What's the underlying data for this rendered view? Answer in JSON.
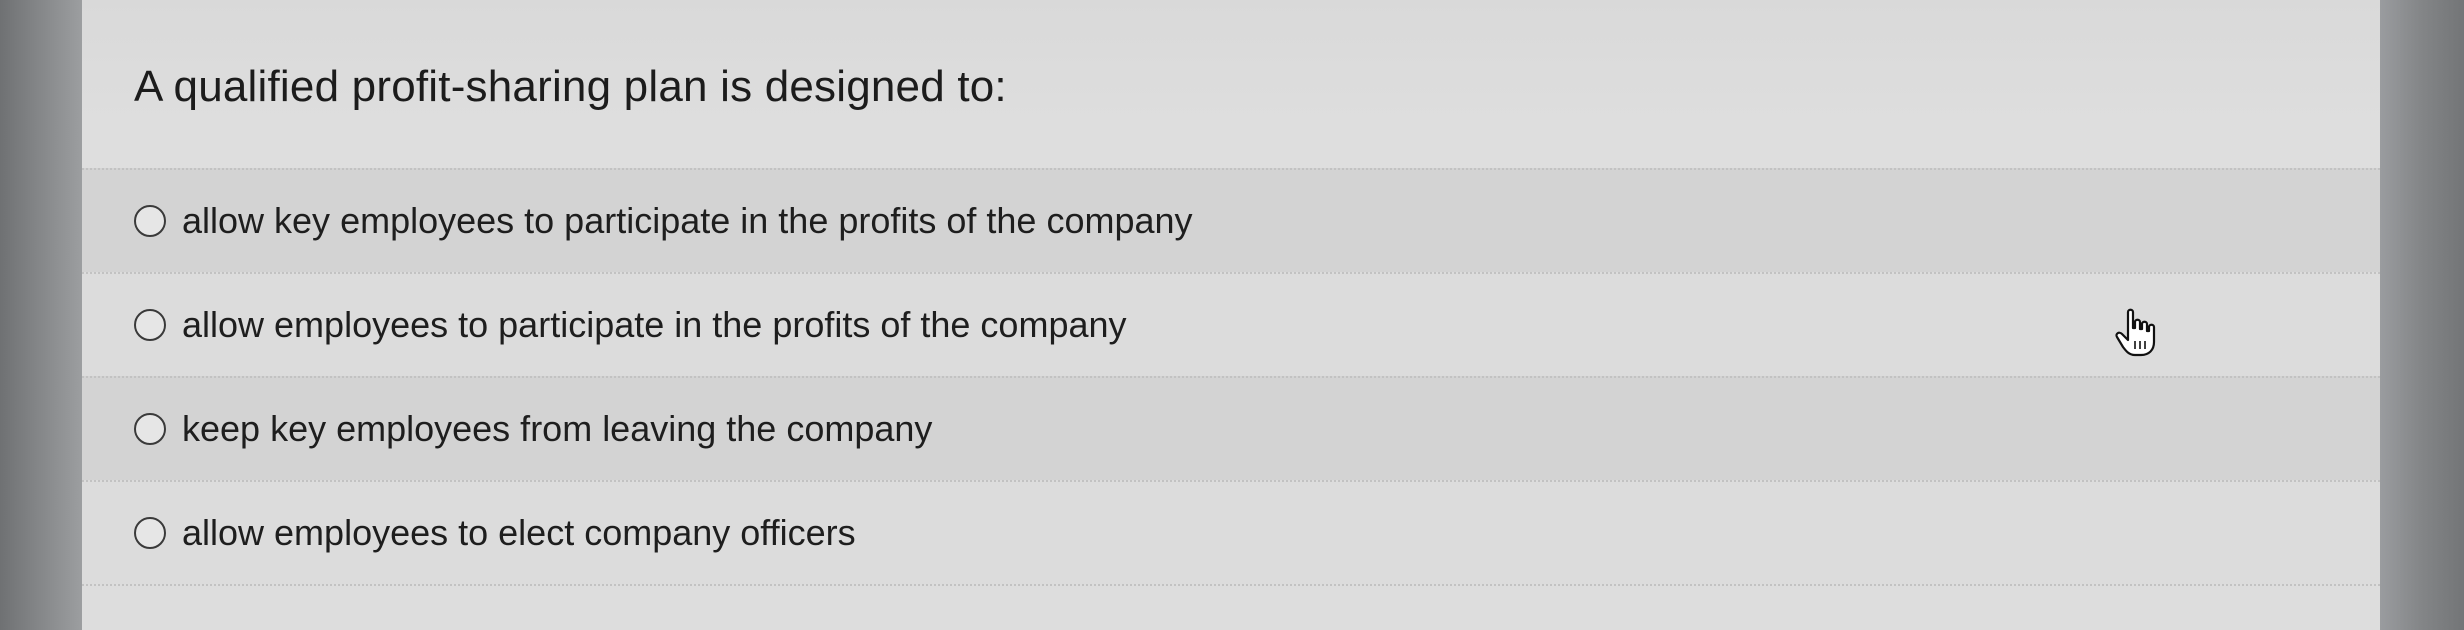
{
  "question": {
    "text": "A qualified profit-sharing plan is designed to:"
  },
  "options": [
    {
      "label": "allow key employees to participate in the profits of the company",
      "selected": false
    },
    {
      "label": "allow employees to participate in the profits of the company",
      "selected": false
    },
    {
      "label": "keep key employees from leaving the company",
      "selected": false
    },
    {
      "label": "allow employees to elect company officers",
      "selected": false
    }
  ],
  "cursor": {
    "icon": "hand-pointer-icon"
  }
}
